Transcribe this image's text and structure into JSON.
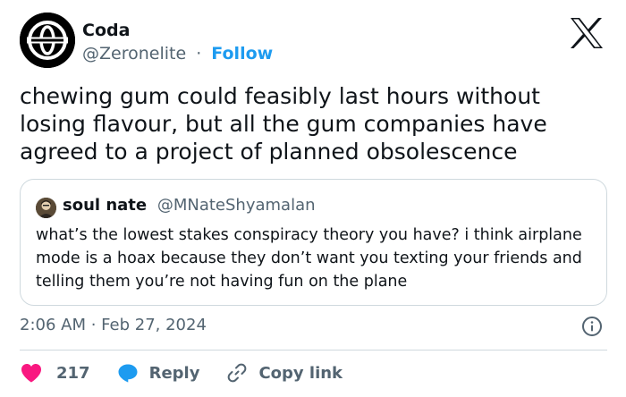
{
  "author": {
    "name": "Coda",
    "handle": "@Zeronelite",
    "separator": "·",
    "follow_label": "Follow"
  },
  "tweet": {
    "text": "chewing gum could feasibly last hours without losing flavour, but all the gum companies have agreed to a project of planned obsolescence",
    "timestamp": "2:06 AM · Feb 27, 2024"
  },
  "quoted": {
    "name": "soul nate",
    "handle": "@MNateShyamalan",
    "text": "what’s the lowest stakes conspiracy theory you have? i think airplane mode is a hoax because they don’t want you texting your friends and telling them you’re not having fun on the plane"
  },
  "actions": {
    "likes": "217",
    "reply_label": "Reply",
    "copy_label": "Copy link"
  },
  "colors": {
    "accent": "#1d9bf0",
    "like": "#f91880",
    "text": "#0f1419",
    "muted": "#536471",
    "border": "#cfd9de"
  },
  "icons": [
    "avatar-logo",
    "x-logo-icon",
    "info-icon",
    "heart-icon",
    "speech-bubble-icon",
    "link-icon"
  ]
}
